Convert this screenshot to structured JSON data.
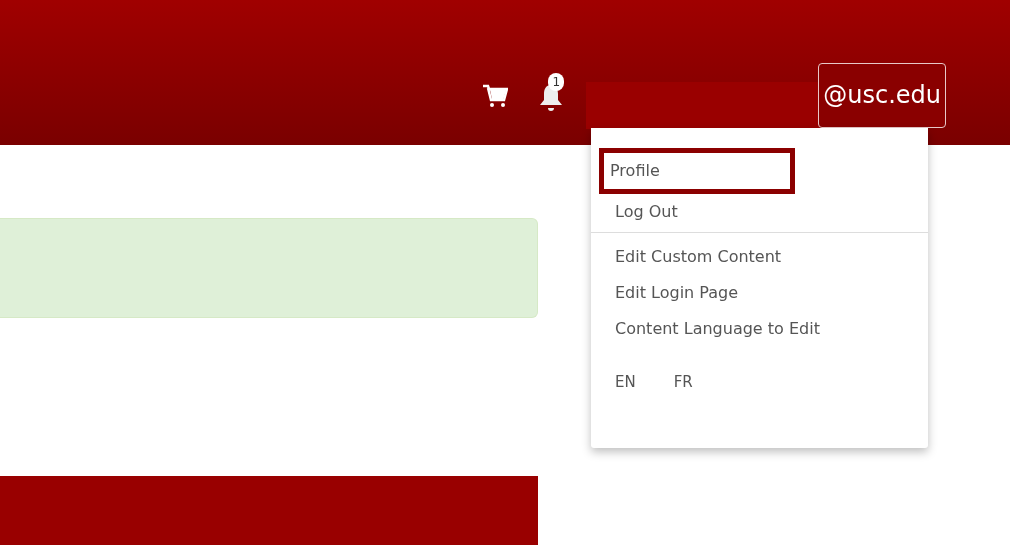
{
  "header": {
    "cart": {
      "kind": "cart"
    },
    "notifications": {
      "count": "1"
    },
    "user": {
      "name": "@usc.edu",
      "redacted": true,
      "expanded": true
    }
  },
  "user_menu": {
    "sections": [
      {
        "items": [
          {
            "label": "Profile",
            "highlighted": true
          },
          {
            "label": "Log Out",
            "highlighted": false
          }
        ]
      },
      {
        "items": [
          {
            "label": "Edit Custom Content",
            "highlighted": false
          },
          {
            "label": "Edit Login Page",
            "highlighted": false
          },
          {
            "label": "Content Language to Edit",
            "highlighted": false
          }
        ]
      }
    ],
    "languages": [
      {
        "code": "EN"
      },
      {
        "code": "FR"
      }
    ]
  },
  "main": {
    "alert": {
      "kind": "success"
    },
    "section_bar": {
      "kind": "primary"
    }
  }
}
